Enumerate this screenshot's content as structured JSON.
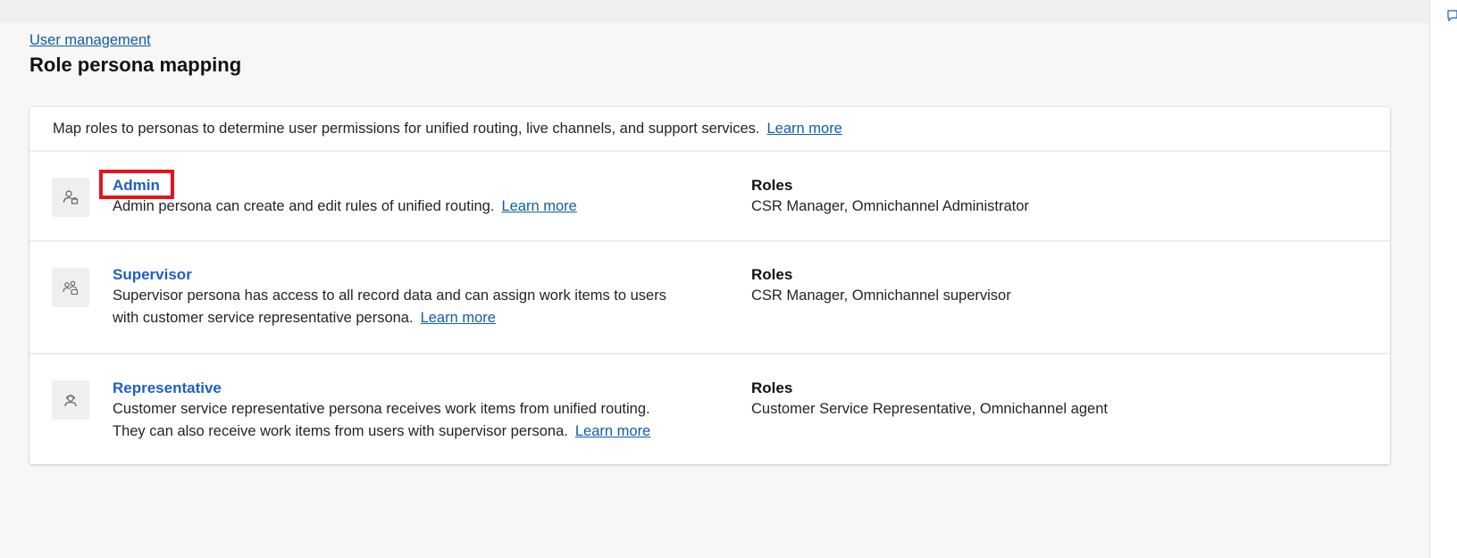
{
  "breadcrumb": "User management",
  "page_title": "Role persona mapping",
  "intro": {
    "text": "Map roles to personas to determine user permissions for unified routing, live channels, and support services.",
    "learn_more": "Learn more"
  },
  "personas": [
    {
      "name": "Admin",
      "icon": "admin-person-icon",
      "description": "Admin persona can create and edit rules of unified routing.",
      "learn_more": "Learn more",
      "roles_label": "Roles",
      "roles": "CSR Manager, Omnichannel Administrator",
      "highlighted": true
    },
    {
      "name": "Supervisor",
      "icon": "supervisor-people-icon",
      "description_line1": "Supervisor persona has access to all record data and can assign work items to users",
      "description_line2": "with customer service representative persona.",
      "learn_more": "Learn more",
      "roles_label": "Roles",
      "roles": "CSR Manager, Omnichannel supervisor"
    },
    {
      "name": "Representative",
      "icon": "headset-person-icon",
      "description_line1": "Customer service representative persona receives work items from unified routing.",
      "description_line2": "They can also receive work items from users with supervisor persona.",
      "learn_more": "Learn more",
      "roles_label": "Roles",
      "roles": "Customer Service Representative, Omnichannel agent"
    }
  ],
  "colors": {
    "link": "#115ea3",
    "persona_name": "#1f5fc0",
    "highlight": "#e8111f",
    "page_background": "#f8f7f6"
  }
}
